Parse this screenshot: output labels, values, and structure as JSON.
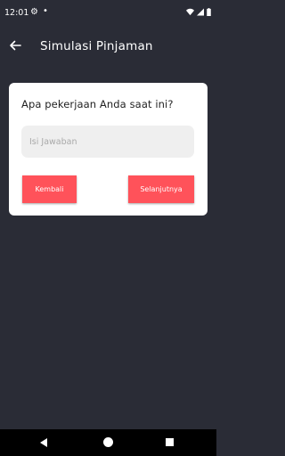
{
  "status_bar": {
    "time": "12:01",
    "icons": [
      "gear-icon",
      "dot-icon",
      "wifi-icon",
      "signal-icon",
      "battery-icon"
    ]
  },
  "app_bar": {
    "title": "Simulasi Pinjaman",
    "back_icon": "arrow-left-icon"
  },
  "card": {
    "question": "Apa pekerjaan Anda saat ini?",
    "answer_value": "",
    "answer_placeholder": "Isi Jawaban",
    "back_label": "Kembali",
    "next_label": "Selanjutnya"
  },
  "colors": {
    "background": "#2a2c36",
    "card": "#ffffff",
    "accent": "#ff525a",
    "input": "#efefef"
  },
  "nav_bar": {
    "icons": [
      "nav-back-icon",
      "nav-home-icon",
      "nav-recents-icon"
    ]
  }
}
